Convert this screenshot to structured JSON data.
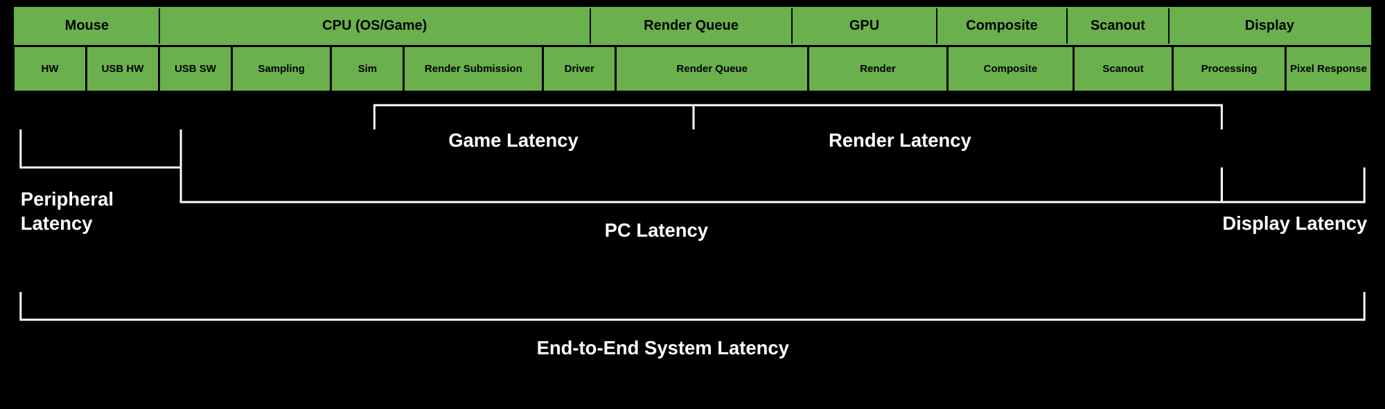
{
  "colors": {
    "green": "#6ab04c",
    "black": "#000000",
    "white": "#ffffff"
  },
  "header": {
    "cells": [
      {
        "label": "Mouse",
        "flex": 10
      },
      {
        "label": "CPU (OS/Game)",
        "flex": 30
      },
      {
        "label": "Render Queue",
        "flex": 14
      },
      {
        "label": "GPU",
        "flex": 10
      },
      {
        "label": "Composite",
        "flex": 9
      },
      {
        "label": "Scanout",
        "flex": 7
      },
      {
        "label": "Display",
        "flex": 14
      }
    ]
  },
  "subheader": {
    "cells": [
      {
        "label": "HW",
        "flex": 5
      },
      {
        "label": "USB HW",
        "flex": 5
      },
      {
        "label": "USB SW",
        "flex": 5
      },
      {
        "label": "Sampling",
        "flex": 7
      },
      {
        "label": "Sim",
        "flex": 5
      },
      {
        "label": "Render Submission",
        "flex": 10
      },
      {
        "label": "Driver",
        "flex": 5
      },
      {
        "label": "Render Queue",
        "flex": 14
      },
      {
        "label": "Render",
        "flex": 10
      },
      {
        "label": "Composite",
        "flex": 9
      },
      {
        "label": "Scanout",
        "flex": 7
      },
      {
        "label": "Processing",
        "flex": 8
      },
      {
        "label": "Pixel Response",
        "flex": 6
      }
    ]
  },
  "labels": {
    "game_latency": "Game Latency",
    "render_latency": "Render Latency",
    "peripheral_latency": "Peripheral Latency",
    "pc_latency": "PC Latency",
    "display_latency": "Display Latency",
    "end_to_end": "End-to-End System Latency"
  }
}
